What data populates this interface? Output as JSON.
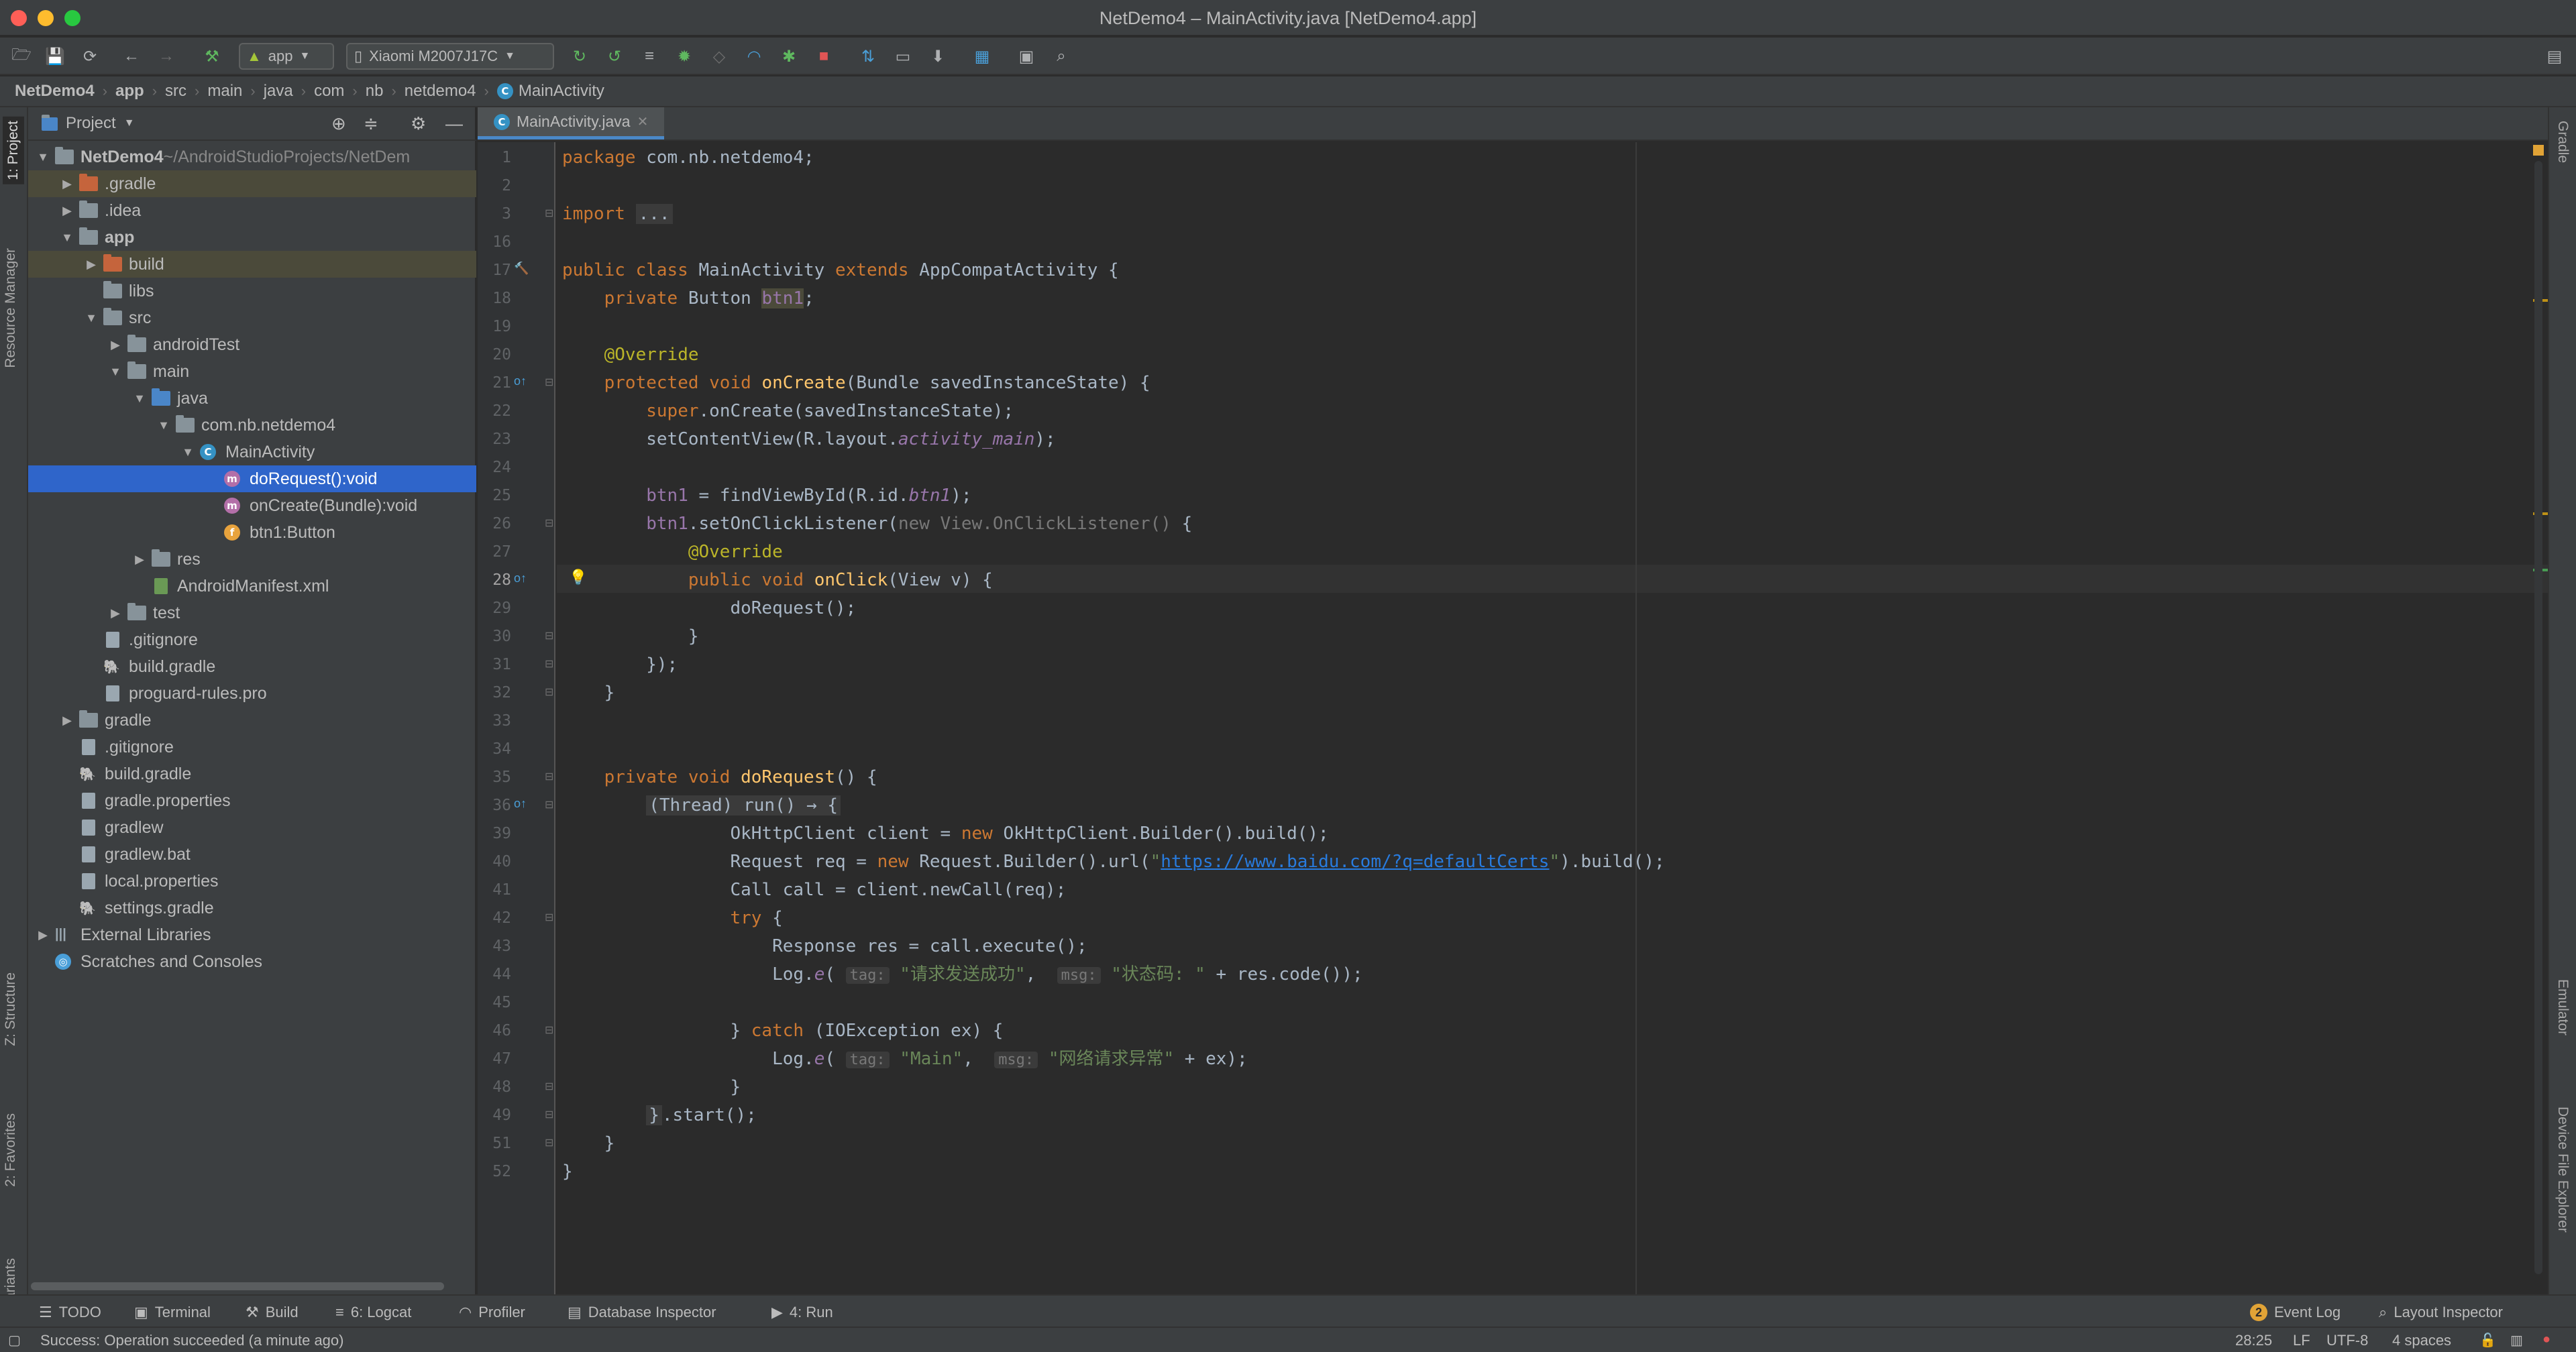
{
  "window": {
    "title": "NetDemo4 – MainActivity.java [NetDemo4.app]"
  },
  "toolbar": {
    "module": "app",
    "device": "Xiaomi M2007J17C"
  },
  "breadcrumb": [
    "NetDemo4",
    "app",
    "src",
    "main",
    "java",
    "com",
    "nb",
    "netdemo4",
    "MainActivity"
  ],
  "project_panel": {
    "title": "Project",
    "tree": [
      {
        "label": "NetDemo4",
        "suffix": "~/AndroidStudioProjects/NetDem",
        "depth": 0,
        "arrow": "down",
        "icon": "module"
      },
      {
        "label": ".gradle",
        "depth": 1,
        "arrow": "right",
        "icon": "folder-orange",
        "hl": true
      },
      {
        "label": ".idea",
        "depth": 1,
        "arrow": "right",
        "icon": "folder"
      },
      {
        "label": "app",
        "depth": 1,
        "arrow": "down",
        "icon": "module"
      },
      {
        "label": "build",
        "depth": 2,
        "arrow": "right",
        "icon": "folder-orange",
        "hl": true
      },
      {
        "label": "libs",
        "depth": 2,
        "arrow": "",
        "icon": "folder"
      },
      {
        "label": "src",
        "depth": 2,
        "arrow": "down",
        "icon": "folder"
      },
      {
        "label": "androidTest",
        "depth": 3,
        "arrow": "right",
        "icon": "folder"
      },
      {
        "label": "main",
        "depth": 3,
        "arrow": "down",
        "icon": "folder"
      },
      {
        "label": "java",
        "depth": 4,
        "arrow": "down",
        "icon": "folder-blue"
      },
      {
        "label": "com.nb.netdemo4",
        "depth": 5,
        "arrow": "down",
        "icon": "package"
      },
      {
        "label": "MainActivity",
        "depth": 6,
        "arrow": "down",
        "icon": "class"
      },
      {
        "label": "doRequest():void",
        "depth": 7,
        "arrow": "",
        "icon": "method",
        "sel": true
      },
      {
        "label": "onCreate(Bundle):void",
        "depth": 7,
        "arrow": "",
        "icon": "method"
      },
      {
        "label": "btn1:Button",
        "depth": 7,
        "arrow": "",
        "icon": "field"
      },
      {
        "label": "res",
        "depth": 4,
        "arrow": "right",
        "icon": "folder-res"
      },
      {
        "label": "AndroidManifest.xml",
        "depth": 4,
        "arrow": "",
        "icon": "manifest"
      },
      {
        "label": "test",
        "depth": 3,
        "arrow": "right",
        "icon": "folder"
      },
      {
        "label": ".gitignore",
        "depth": 2,
        "arrow": "",
        "icon": "file"
      },
      {
        "label": "build.gradle",
        "depth": 2,
        "arrow": "",
        "icon": "gradle"
      },
      {
        "label": "proguard-rules.pro",
        "depth": 2,
        "arrow": "",
        "icon": "file"
      },
      {
        "label": "gradle",
        "depth": 1,
        "arrow": "right",
        "icon": "folder"
      },
      {
        "label": ".gitignore",
        "depth": 1,
        "arrow": "",
        "icon": "file"
      },
      {
        "label": "build.gradle",
        "depth": 1,
        "arrow": "",
        "icon": "gradle"
      },
      {
        "label": "gradle.properties",
        "depth": 1,
        "arrow": "",
        "icon": "file"
      },
      {
        "label": "gradlew",
        "depth": 1,
        "arrow": "",
        "icon": "file"
      },
      {
        "label": "gradlew.bat",
        "depth": 1,
        "arrow": "",
        "icon": "file"
      },
      {
        "label": "local.properties",
        "depth": 1,
        "arrow": "",
        "icon": "file"
      },
      {
        "label": "settings.gradle",
        "depth": 1,
        "arrow": "",
        "icon": "gradle"
      },
      {
        "label": "External Libraries",
        "depth": 0,
        "arrow": "right",
        "icon": "libs"
      },
      {
        "label": "Scratches and Consoles",
        "depth": 0,
        "arrow": "",
        "icon": "scratch"
      }
    ]
  },
  "left_stripe": {
    "project": "1: Project",
    "resource": "Resource Manager",
    "structure": "Z: Structure",
    "favorites": "2: Favorites",
    "variants": "Build Variants"
  },
  "right_stripe": {
    "gradle": "Gradle",
    "emulator": "Emulator",
    "device_explorer": "Device File Explorer"
  },
  "editor": {
    "tab": "MainActivity.java",
    "line_numbers": [
      "1",
      "2",
      "3",
      "16",
      "17",
      "18",
      "19",
      "20",
      "21",
      "22",
      "23",
      "24",
      "25",
      "26",
      "27",
      "28",
      "29",
      "30",
      "31",
      "32",
      "33",
      "34",
      "35",
      "36",
      "39",
      "40",
      "41",
      "42",
      "43",
      "44",
      "45",
      "46",
      "47",
      "48",
      "49",
      "51",
      "52"
    ],
    "code": [
      [
        [
          "kw",
          "package "
        ],
        [
          "",
          "com.nb.netdemo4;"
        ]
      ],
      [],
      [
        [
          "kw",
          "import "
        ],
        [
          "fold",
          "..."
        ]
      ],
      [],
      [
        [
          "kw",
          "public class "
        ],
        [
          "",
          "MainActivity "
        ],
        [
          "kw",
          "extends "
        ],
        [
          "",
          "AppCompatActivity {"
        ]
      ],
      [
        [
          "",
          "    "
        ],
        [
          "kw",
          "private "
        ],
        [
          "",
          "Button "
        ],
        [
          "fld",
          "btn1"
        ],
        [
          "",
          ";"
        ]
      ],
      [],
      [
        [
          "",
          "    "
        ],
        [
          "ann",
          "@Override"
        ]
      ],
      [
        [
          "",
          "    "
        ],
        [
          "kw",
          "protected void "
        ],
        [
          "fn",
          "onCreate"
        ],
        [
          "",
          "(Bundle savedInstanceState) {"
        ]
      ],
      [
        [
          "",
          "        "
        ],
        [
          "kw",
          "super"
        ],
        [
          "",
          ".onCreate(savedInstanceState);"
        ]
      ],
      [
        [
          "",
          "        setContentView(R.layout."
        ],
        [
          "it",
          "activity_main"
        ],
        [
          "",
          ");"
        ]
      ],
      [],
      [
        [
          "",
          "        "
        ],
        [
          "fld",
          "btn1"
        ],
        [
          "",
          " = findViewById(R.id."
        ],
        [
          "it",
          "btn1"
        ],
        [
          "",
          ");"
        ]
      ],
      [
        [
          "",
          "        "
        ],
        [
          "fld",
          "btn1"
        ],
        [
          "",
          ".setOnClickListener("
        ],
        [
          "gr",
          "new View.OnClickListener() "
        ],
        [
          "",
          "{"
        ]
      ],
      [
        [
          "",
          "            "
        ],
        [
          "ann",
          "@Override"
        ]
      ],
      [
        [
          "",
          "            "
        ],
        [
          "kw",
          "public void "
        ],
        [
          "fn",
          "onClick"
        ],
        [
          "",
          "(View v) {"
        ]
      ],
      [
        [
          "",
          "                doRequest();"
        ]
      ],
      [
        [
          "",
          "            }"
        ]
      ],
      [
        [
          "",
          "        });"
        ]
      ],
      [
        [
          "",
          "    }"
        ]
      ],
      [],
      [],
      [
        [
          "",
          "    "
        ],
        [
          "kw",
          "private void "
        ],
        [
          "fn",
          "doRequest"
        ],
        [
          "",
          "() {"
        ]
      ],
      [
        [
          "",
          "        "
        ],
        [
          "fold",
          "(Thread) run() → {"
        ]
      ],
      [
        [
          "",
          "                OkHttpClient client = "
        ],
        [
          "kw",
          "new "
        ],
        [
          "",
          "OkHttpClient.Builder().build();"
        ]
      ],
      [
        [
          "",
          "                Request req = "
        ],
        [
          "kw",
          "new "
        ],
        [
          "",
          "Request.Builder().url("
        ],
        [
          "str",
          "\""
        ],
        [
          "url",
          "https://www.baidu.com/?q=defaultCerts"
        ],
        [
          "str",
          "\""
        ],
        [
          "",
          ").build();"
        ]
      ],
      [
        [
          "",
          "                Call call = client.newCall(req);"
        ]
      ],
      [
        [
          "",
          "                "
        ],
        [
          "kw",
          "try "
        ],
        [
          "",
          "{"
        ]
      ],
      [
        [
          "",
          "                    Response res = call.execute();"
        ]
      ],
      [
        [
          "",
          "                    Log."
        ],
        [
          "it",
          "e"
        ],
        [
          "",
          "( "
        ],
        [
          "hint",
          "tag:"
        ],
        [
          "str",
          " \"请求发送成功\""
        ],
        [
          "",
          ",  "
        ],
        [
          "hint",
          "msg:"
        ],
        [
          "str",
          " \"状态码: \""
        ],
        [
          "",
          " + res.code());"
        ]
      ],
      [],
      [
        [
          "",
          "                } "
        ],
        [
          "kw",
          "catch "
        ],
        [
          "",
          "(IOException ex) {"
        ]
      ],
      [
        [
          "",
          "                    Log."
        ],
        [
          "it",
          "e"
        ],
        [
          "",
          "( "
        ],
        [
          "hint",
          "tag:"
        ],
        [
          "str",
          " \"Main\""
        ],
        [
          "",
          ",  "
        ],
        [
          "hint",
          "msg:"
        ],
        [
          "str",
          " \"网络请求异常\""
        ],
        [
          "",
          " + ex);"
        ]
      ],
      [
        [
          "",
          "                }"
        ]
      ],
      [
        [
          "",
          "        "
        ],
        [
          "fold",
          "}"
        ],
        [
          "",
          ".start();"
        ]
      ],
      [
        [
          "",
          "    }"
        ]
      ],
      [
        [
          "",
          "}"
        ]
      ]
    ]
  },
  "bottom_tabs": [
    {
      "label": "TODO",
      "icon": "list-icon"
    },
    {
      "label": "Terminal",
      "icon": "terminal-icon"
    },
    {
      "label": "Build",
      "icon": "hammer-icon"
    },
    {
      "label": "6: Logcat",
      "icon": "logcat-icon"
    },
    {
      "label": "Profiler",
      "icon": "profiler-icon"
    },
    {
      "label": "Database Inspector",
      "icon": "database-icon"
    },
    {
      "label": "4: Run",
      "icon": "run-icon"
    }
  ],
  "bottom_right_tabs": [
    {
      "label": "Event Log",
      "badge": "2"
    },
    {
      "label": "Layout Inspector"
    }
  ],
  "status": {
    "message": "Success: Operation succeeded (a minute ago)",
    "position": "28:25",
    "line_sep": "LF",
    "encoding": "UTF-8",
    "indent": "4 spaces"
  },
  "colors": {
    "accent": "#2f65ca",
    "background": "#2b2b2b",
    "panel": "#3c3f41",
    "keyword": "#cc7832",
    "string": "#6a8759",
    "function": "#ffc66d"
  }
}
